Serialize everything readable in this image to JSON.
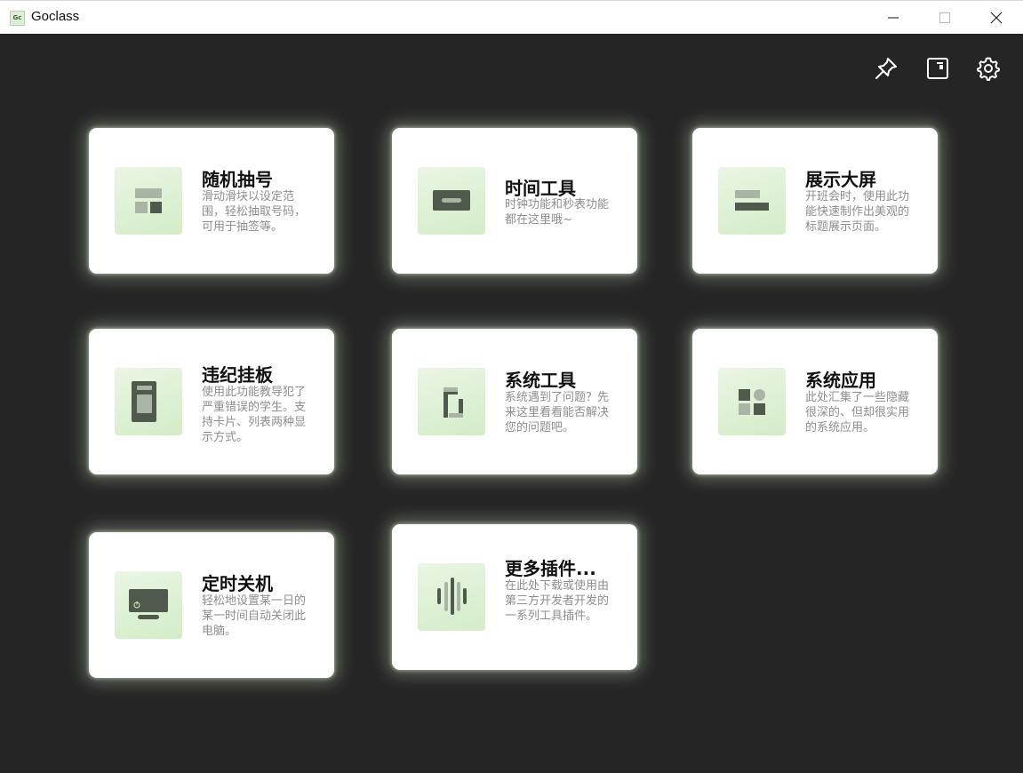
{
  "window": {
    "title": "Goclass",
    "icon_text": "Gc",
    "accent_color": "#d3ecc7",
    "background_color": "#252525"
  },
  "toolbar": {
    "icons": [
      "pin-icon",
      "sidebar-panel-icon",
      "gear-icon"
    ]
  },
  "cards": [
    {
      "title": "随机抽号",
      "desc": "滑动滑块以设定范围，轻松抽取号码，可用于抽签等。",
      "icon": "layout-blocks-icon"
    },
    {
      "title": "时间工具",
      "desc": "时钟功能和秒表功能都在这里哦~",
      "icon": "clock-display-icon"
    },
    {
      "title": "展示大屏",
      "desc": "开班会时，使用此功能快速制作出美观的标题展示页面。",
      "icon": "banner-bars-icon"
    },
    {
      "title": "违纪挂板",
      "desc": "使用此功能教导犯了严重错误的学生。支持卡片、列表两种显示方式。",
      "icon": "board-icon"
    },
    {
      "title": "系统工具",
      "desc": "系统遇到了问题？先来这里看看能否解决您的问题吧。",
      "icon": "brackets-icon"
    },
    {
      "title": "系统应用",
      "desc": "此处汇集了一些隐藏很深的、但却很实用的系统应用。",
      "icon": "apps-grid-icon"
    },
    {
      "title": "定时关机",
      "desc": "轻松地设置某一日的某一时间自动关闭此电脑。",
      "icon": "monitor-power-icon"
    },
    {
      "title": "更多插件...",
      "desc": "在此处下载或使用由第三方开发者开发的一系列工具插件。",
      "icon": "plugin-bars-icon"
    }
  ]
}
